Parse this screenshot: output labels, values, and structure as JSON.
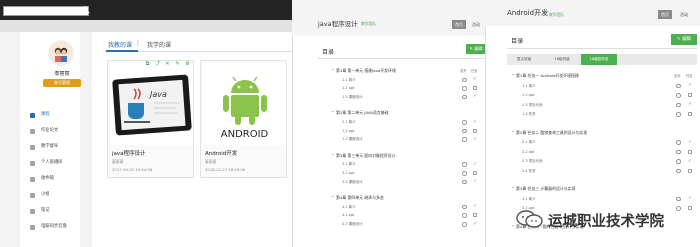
{
  "panel1": {
    "user_name": "泰丽丽",
    "user_btn": "账号管理",
    "nav": [
      "课程",
      "作业论文",
      "教学督导",
      "个人直播间",
      "收件箱",
      "小组",
      "笔记",
      "电脑同步云盘"
    ],
    "tabs": [
      "我教的课",
      "我学的课"
    ],
    "courses": [
      {
        "title": "java程序设计",
        "teacher": "泰丽丽",
        "time": "2017-04-20 10:54:58"
      },
      {
        "title": "Android开发",
        "teacher": "泰丽丽",
        "time": "2018-12-27 16:45:09"
      }
    ],
    "android_logo_text": "ANDROID",
    "java_text": "Java"
  },
  "panel2": {
    "title": "java程序设计",
    "subtitle": "教学团队",
    "btn_home": "首页",
    "btn_activity": "活动",
    "mulu": "目录",
    "edit": "编辑",
    "col_publish": "发布",
    "col_status": "任务",
    "chapters": [
      {
        "title": "第1章 第一单元 搭建Java开发环境",
        "lessons": [
          "1.1 简介",
          "1.2 ppt",
          "1.3 课程设计"
        ]
      },
      {
        "title": "第2章 第二单元 JAVA语言基础",
        "lessons": [
          "2.1 简介",
          "2.2 ppt",
          "2.3 课程设计"
        ]
      },
      {
        "title": "第3章 第三单元 面向对象程序设计",
        "lessons": [
          "3.1 简介",
          "3.2 ppt",
          "3.3 课程设计"
        ]
      },
      {
        "title": "第4章 第四单元 继承与多态",
        "lessons": [
          "4.1 简介",
          "4.2 ppt",
          "4.3 课程设计"
        ]
      }
    ]
  },
  "panel3": {
    "title": "Android开发",
    "subtitle": "教学团队",
    "btn_home": "首页",
    "btn_activity": "活动",
    "mulu": "目录",
    "edit": "编辑",
    "tabs": [
      "复认班级",
      "18级班级",
      "18级软件班"
    ],
    "col_publish": "发布",
    "col_status": "任务",
    "chapters": [
      {
        "title": "第1章 任务一 Android开发环境搭建",
        "lessons": [
          "1.1 简介",
          "1.2 ppt",
          "1.3 项目代码",
          "1.4 任务"
        ]
      },
      {
        "title": "第2章 任务二 酷旅查询工具的设计与实现",
        "lessons": [
          "2.1 简介",
          "2.2 ppt",
          "2.3 项目代码",
          "2.4 任务"
        ]
      },
      {
        "title": "第3章 任务三 计算器的设计与实现",
        "lessons": [
          "3.1 简介",
          "3.2 ppt"
        ]
      },
      {
        "title": "第4章 任务四 “我的日记”的设计与实现",
        "lessons": []
      }
    ]
  },
  "watermark": "运城职业技术学院",
  "colors": {
    "accent_green": "#4caf50",
    "accent_blue": "#2d6bb5",
    "orange": "#e39b1a",
    "topbar": "#242424"
  }
}
